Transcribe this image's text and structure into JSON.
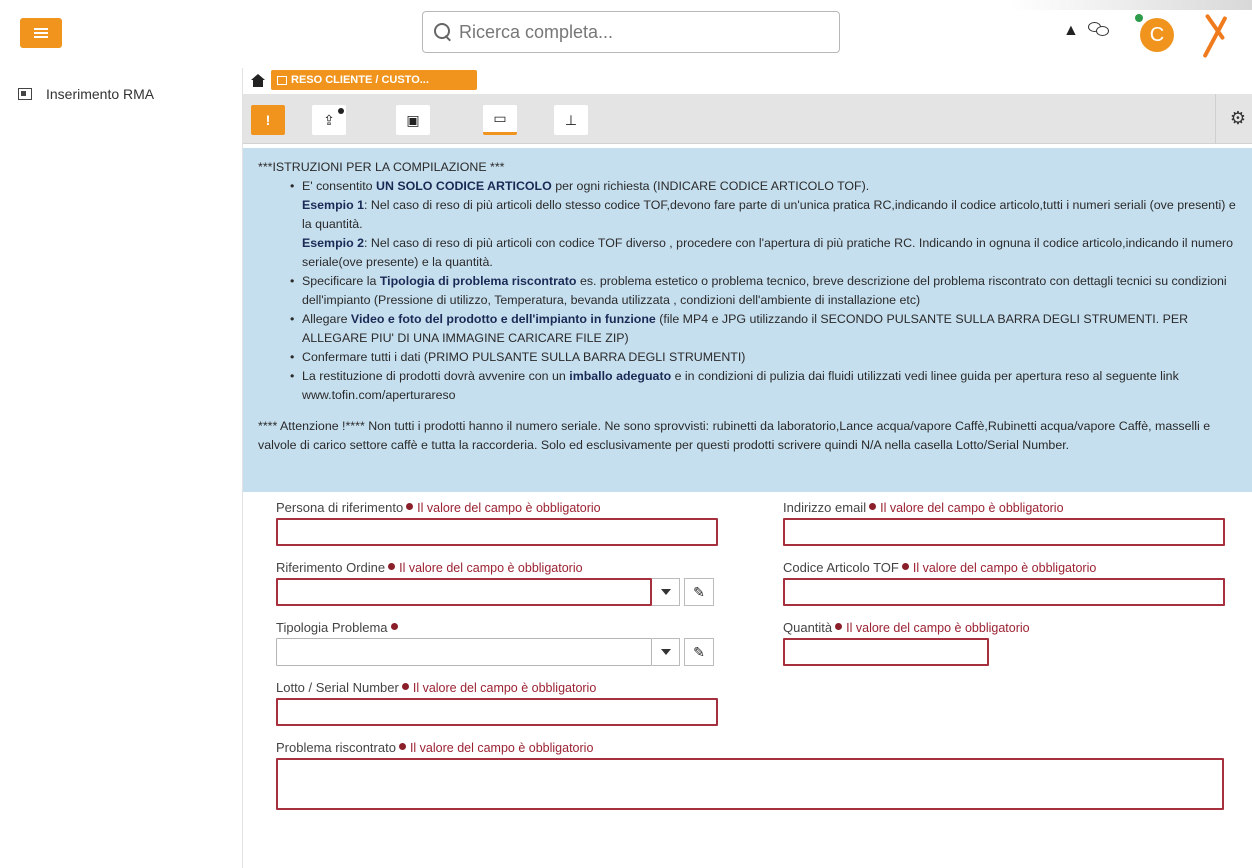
{
  "header": {
    "search_placeholder": "Ricerca completa...",
    "avatar_letter": "C"
  },
  "sidebar": {
    "items": [
      {
        "label": "Inserimento RMA"
      }
    ]
  },
  "breadcrumb": {
    "tab_label": "RESO CLIENTE / CUSTO..."
  },
  "toolbar": {
    "alert_label": "!"
  },
  "instructions": {
    "title": "***ISTRUZIONI PER LA COMPILAZIONE ***",
    "b1_pre": "E' consentito ",
    "b1_bold": "UN SOLO CODICE ARTICOLO",
    "b1_post": " per ogni richiesta (INDICARE CODICE ARTICOLO TOF).",
    "ex1_bold": "Esempio 1",
    "ex1_text": ": Nel caso di reso di più articoli dello stesso codice TOF,devono fare parte di un'unica pratica RC,indicando il codice articolo,tutti i numeri seriali (ove presenti) e la quantità.",
    "ex2_bold": "Esempio 2",
    "ex2_text": ": Nel caso di reso di più articoli con codice TOF diverso , procedere con l'apertura di più pratiche RC. Indicando in ognuna il codice articolo,indicando il numero seriale(ove presente) e la quantità.",
    "b2_pre": "Specificare la ",
    "b2_bold": "Tipologia di problema riscontrato",
    "b2_post": " es. problema estetico o problema tecnico, breve descrizione del problema riscontrato con dettagli tecnici su condizioni dell'impianto (Pressione di utilizzo, Temperatura, bevanda utilizzata , condizioni dell'ambiente di installazione etc)",
    "b3_pre": "Allegare ",
    "b3_bold": "Video e foto del prodotto e dell'impianto in funzione",
    "b3_post": " (file MP4 e JPG utilizzando il SECONDO PULSANTE SULLA BARRA DEGLI STRUMENTI. PER ALLEGARE PIU' DI UNA IMMAGINE CARICARE FILE ZIP)",
    "b4": "Confermare tutti i dati (PRIMO PULSANTE SULLA BARRA DEGLI STRUMENTI)",
    "b5_pre": "La restituzione di prodotti dovrà avvenire con un ",
    "b5_bold": "imballo adeguato",
    "b5_post": " e in condizioni di pulizia dai fluidi utilizzati vedi linee guida per apertura reso al seguente link www.tofin.com/aperturareso",
    "note": "**** Attenzione !**** Non tutti i prodotti hanno il numero seriale. Ne sono sprovvisti: rubinetti da laboratorio,Lance acqua/vapore Caffè,Rubinetti acqua/vapore Caffè, masselli e valvole di carico settore caffè e tutta la raccorderia. Solo ed esclusivamente per questi prodotti scrivere quindi N/A nella casella Lotto/Serial Number."
  },
  "form": {
    "required_msg": "Il valore del campo è obbligatorio",
    "persona_label": "Persona di riferimento",
    "email_label": "Indirizzo email",
    "ordine_label": "Riferimento Ordine",
    "codice_label": "Codice Articolo TOF",
    "tipologia_label": "Tipologia Problema",
    "quantita_label": "Quantità",
    "lotto_label": "Lotto / Serial Number",
    "problema_label": "Problema riscontrato"
  },
  "colors": {
    "accent": "#f0941d",
    "error": "#9b2232",
    "info_bg": "#c6dfef"
  }
}
